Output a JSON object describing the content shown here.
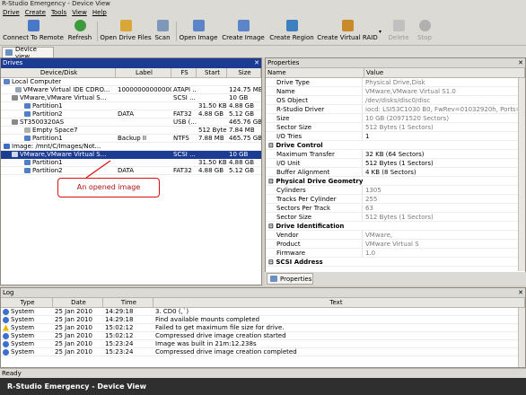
{
  "window": {
    "title": "R-Studio Emergency - Device View"
  },
  "menu": [
    "Drive",
    "Create",
    "Tools",
    "View",
    "Help"
  ],
  "toolbar": {
    "connect": "Connect To Remote",
    "refresh": "Refresh",
    "open_drive_files": "Open Drive Files",
    "scan": "Scan",
    "open_image": "Open Image",
    "create_image": "Create Image",
    "create_region": "Create Region",
    "create_virtual_raid": "Create Virtual RAID",
    "delete": "Delete",
    "stop": "Stop"
  },
  "tabs": {
    "device_view": "Device view"
  },
  "drives": {
    "title": "Drives",
    "columns": [
      "Device/Disk",
      "Label",
      "FS",
      "Start",
      "Size"
    ],
    "rows": [
      {
        "name": "Local Computer",
        "label": "",
        "fs": "",
        "start": "",
        "size": ""
      },
      {
        "name": "VMware Virtual IDE CDRO...",
        "label": "10000000000000...",
        "fs": "ATAPI ...",
        "start": "",
        "size": "124.75 MB"
      },
      {
        "name": "VMware,VMware Virtual S...",
        "label": "",
        "fs": "SCSI ...",
        "start": "",
        "size": "10 GB"
      },
      {
        "name": "Partition1",
        "label": "",
        "fs": "",
        "start": "31.50 KB",
        "size": "4.88 GB"
      },
      {
        "name": "Partition2",
        "label": "DATA",
        "fs": "FAT32",
        "start": "4.88 GB",
        "size": "5.12 GB"
      },
      {
        "name": "ST3500320AS",
        "label": "",
        "fs": "USB (...",
        "start": "",
        "size": "465.76 GB"
      },
      {
        "name": "Empty Space7",
        "label": "",
        "fs": "",
        "start": "512 Bytes",
        "size": "7.84 MB"
      },
      {
        "name": "Partition1",
        "label": "Backup II",
        "fs": "NTFS",
        "start": "7.88 MB",
        "size": "465.75 GB"
      },
      {
        "name": "Image: /mnt/C/Images/Not...",
        "label": "",
        "fs": "",
        "start": "",
        "size": ""
      },
      {
        "name": "VMware,VMware Virtual S...",
        "label": "",
        "fs": "SCSI ...",
        "start": "",
        "size": "10 GB"
      },
      {
        "name": "Partition1",
        "label": "",
        "fs": "",
        "start": "31.50 KB",
        "size": "4.88 GB"
      },
      {
        "name": "Partition2",
        "label": "DATA",
        "fs": "FAT32",
        "start": "4.88 GB",
        "size": "5.12 GB"
      }
    ],
    "callout": "An opened image"
  },
  "properties": {
    "title": "Properties",
    "columns": [
      "Name",
      "Value"
    ],
    "rows": [
      {
        "n": "Drive Type",
        "v": "Physical Drive,Disk"
      },
      {
        "n": "Name",
        "v": "VMware,VMware Virtual S1.0"
      },
      {
        "n": "OS Object",
        "v": "/dev/disks/disc0/disc"
      },
      {
        "n": "R-Studio Driver",
        "v": "iocd: LSI53C1030 B0, FwRev=01032920h, Ports=1,..."
      },
      {
        "n": "Size",
        "v": "10 GB (20971520 Sectors)"
      },
      {
        "n": "Sector Size",
        "v": "512 Bytes (1 Sectors)"
      },
      {
        "n": "I/O Tries",
        "v": "1"
      }
    ],
    "cat_drive_control": "Drive Control",
    "drive_control": [
      {
        "n": "Maximum Transfer",
        "v": "32 KB (64 Sectors)"
      },
      {
        "n": "I/O Unit",
        "v": "512 Bytes (1 Sectors)"
      },
      {
        "n": "Buffer Alignment",
        "v": "4 KB (8 Sectors)"
      }
    ],
    "cat_geometry": "Physical Drive Geometry",
    "geometry": [
      {
        "n": "Cylinders",
        "v": "1305"
      },
      {
        "n": "Tracks Per Cylinder",
        "v": "255"
      },
      {
        "n": "Sectors Per Track",
        "v": "63"
      },
      {
        "n": "Sector Size",
        "v": "512 Bytes (1 Sectors)"
      }
    ],
    "cat_identification": "Drive Identification",
    "identification": [
      {
        "n": "Vendor",
        "v": "VMware,"
      },
      {
        "n": "Product",
        "v": "VMware Virtual S"
      },
      {
        "n": "Firmware",
        "v": "1.0"
      }
    ],
    "cat_scsi": "SCSI Address",
    "tab": "Properties"
  },
  "log": {
    "title": "Log",
    "columns": [
      "Type",
      "Date",
      "Time",
      "Text"
    ],
    "rows": [
      {
        "type": "System",
        "date": "25 Jan 2010",
        "time": "14:29:18",
        "text": "3. CD0 (,`)",
        "warn": false
      },
      {
        "type": "System",
        "date": "25 Jan 2010",
        "time": "14:29:18",
        "text": "Find available mounts completed",
        "warn": false
      },
      {
        "type": "System",
        "date": "25 Jan 2010",
        "time": "15:02:12",
        "text": "Failed to get maximum file size for drive.",
        "warn": true
      },
      {
        "type": "System",
        "date": "25 Jan 2010",
        "time": "15:02:12",
        "text": "Compressed drive image creation started",
        "warn": false
      },
      {
        "type": "System",
        "date": "25 Jan 2010",
        "time": "15:23:24",
        "text": "Image was built in 21m:12.238s",
        "warn": false
      },
      {
        "type": "System",
        "date": "25 Jan 2010",
        "time": "15:23:24",
        "text": "Compressed drive image creation completed",
        "warn": false
      }
    ]
  },
  "status": {
    "text": "Ready"
  },
  "taskbar": {
    "title": "R-Studio Emergency - Device View"
  }
}
